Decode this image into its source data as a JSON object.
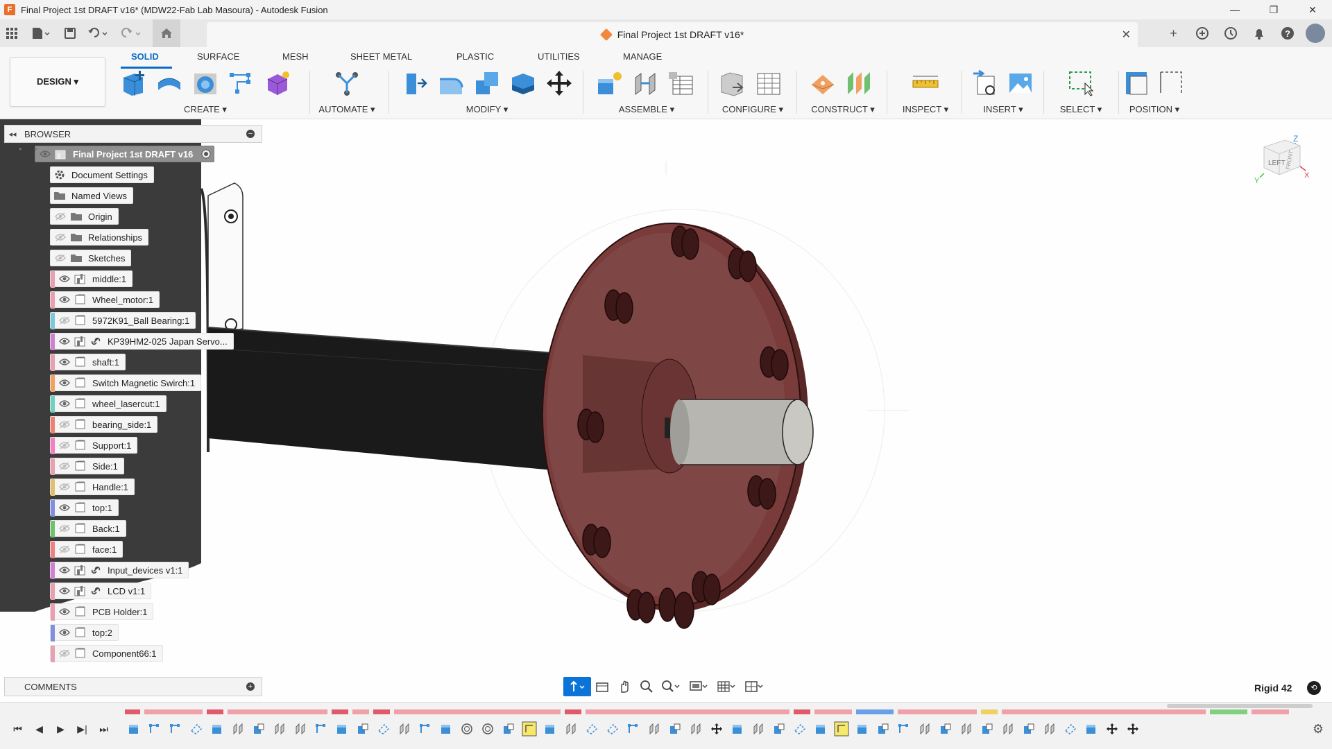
{
  "window": {
    "title": "Final Project 1st DRAFT v16* (MDW22-Fab Lab Masoura) - Autodesk Fusion",
    "minimize": "—",
    "restore": "❐",
    "close": "✕"
  },
  "doc_tab": {
    "title": "Final Project 1st DRAFT v16*",
    "close": "✕"
  },
  "ribbon": {
    "workspace": "DESIGN ▾",
    "tabs": [
      {
        "label": "SOLID",
        "active": true
      },
      {
        "label": "SURFACE"
      },
      {
        "label": "MESH"
      },
      {
        "label": "SHEET METAL"
      },
      {
        "label": "PLASTIC"
      },
      {
        "label": "UTILITIES"
      },
      {
        "label": "MANAGE"
      }
    ],
    "groups": {
      "create": "CREATE ▾",
      "automate": "AUTOMATE ▾",
      "modify": "MODIFY ▾",
      "assemble": "ASSEMBLE ▾",
      "configure": "CONFIGURE ▾",
      "construct": "CONSTRUCT ▾",
      "inspect": "INSPECT ▾",
      "insert": "INSERT ▾",
      "select": "SELECT ▾",
      "position": "POSITION ▾"
    }
  },
  "browser": {
    "title": "BROWSER",
    "items": [
      {
        "label": "Final Project 1st DRAFT v16",
        "root": true,
        "visible": true
      },
      {
        "label": "Document Settings",
        "icon": "gear-icon",
        "visible": null
      },
      {
        "label": "Named Views",
        "icon": "folder-icon",
        "visible": null
      },
      {
        "label": "Origin",
        "icon": "folder-icon",
        "visible": false
      },
      {
        "label": "Relationships",
        "icon": "folder-icon",
        "visible": false
      },
      {
        "label": "Sketches",
        "icon": "folder-icon",
        "visible": false
      },
      {
        "label": "middle:1",
        "icon": "component-icon",
        "visible": true,
        "color": "#e8a0b0"
      },
      {
        "label": "Wheel_motor:1",
        "icon": "body-icon",
        "visible": true,
        "color": "#e8a0b0"
      },
      {
        "label": "5972K91_Ball Bearing:1",
        "icon": "body-icon",
        "visible": false,
        "color": "#80c8d8"
      },
      {
        "label": "KP39HM2-025 Japan Servo...",
        "icon": "component-icon",
        "link": true,
        "visible": true,
        "color": "#d080d0"
      },
      {
        "label": "shaft:1",
        "icon": "body-icon",
        "visible": true,
        "color": "#e8a0b0"
      },
      {
        "label": "Switch Magnetic Swirch:1",
        "icon": "body-icon",
        "visible": true,
        "color": "#f0a060"
      },
      {
        "label": "wheel_lasercut:1",
        "icon": "body-icon",
        "visible": true,
        "color": "#70d0c0"
      },
      {
        "label": "bearing_side:1",
        "icon": "body-icon",
        "visible": false,
        "color": "#f08070"
      },
      {
        "label": "Support:1",
        "icon": "body-icon",
        "visible": false,
        "color": "#f080c0"
      },
      {
        "label": "Side:1",
        "icon": "body-icon",
        "visible": false,
        "color": "#e8a0b0"
      },
      {
        "label": "Handle:1",
        "icon": "body-icon",
        "visible": false,
        "color": "#e0c070"
      },
      {
        "label": "top:1",
        "icon": "body-icon",
        "visible": true,
        "color": "#8090e0"
      },
      {
        "label": "Back:1",
        "icon": "body-icon",
        "visible": false,
        "color": "#70c070"
      },
      {
        "label": "face:1",
        "icon": "body-icon",
        "visible": false,
        "color": "#f08080"
      },
      {
        "label": "Input_devices v1:1",
        "icon": "component-icon",
        "link": true,
        "visible": true,
        "color": "#d080d0"
      },
      {
        "label": "LCD v1:1",
        "icon": "component-icon",
        "link": true,
        "visible": true,
        "color": "#e8a0b0"
      },
      {
        "label": "PCB Holder:1",
        "icon": "body-icon",
        "visible": true,
        "color": "#e8a0b0"
      },
      {
        "label": "top:2",
        "icon": "body-icon",
        "visible": true,
        "color": "#8090e0"
      },
      {
        "label": "Component66:1",
        "icon": "body-icon",
        "visible": false,
        "color": "#e8a0b0"
      }
    ]
  },
  "comments": {
    "title": "COMMENTS"
  },
  "status": {
    "mode": "Rigid 42"
  },
  "viewcube": {
    "face_left": "LEFT",
    "face_front": "FRONT",
    "axis_z": "Z",
    "axis_x": "X",
    "axis_y": "Y"
  },
  "colors": {
    "accent": "#0a6bc5",
    "flange": "#7a3b3b",
    "shaft": "#1a1a1a"
  }
}
